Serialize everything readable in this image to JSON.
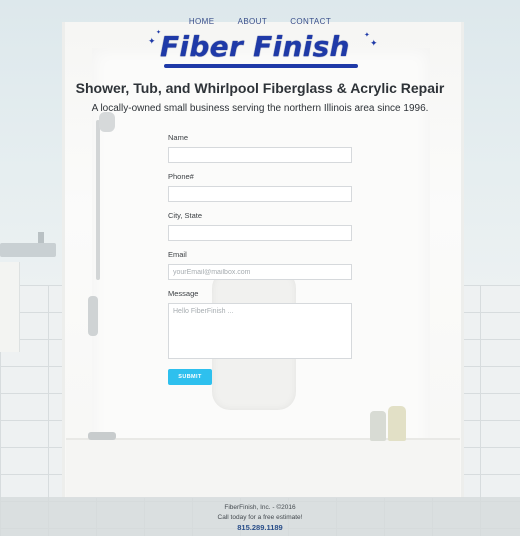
{
  "nav": {
    "items": [
      {
        "label": "HOME"
      },
      {
        "label": "ABOUT"
      },
      {
        "label": "CONTACT"
      }
    ]
  },
  "brand": {
    "logo_text": "Fiber Finish",
    "tagline": "Shower, Tub, and Whirlpool Fiberglass & Acrylic Repair",
    "subline": "A locally-owned small business serving the northern Illinois area since 1996.",
    "logo_color": "#1f3aa8"
  },
  "form": {
    "fields": [
      {
        "label": "Name",
        "placeholder": "",
        "value": ""
      },
      {
        "label": "Phone#",
        "placeholder": "",
        "value": ""
      },
      {
        "label": "City, State",
        "placeholder": "",
        "value": ""
      },
      {
        "label": "Email",
        "placeholder": "yourEmail@mailbox.com",
        "value": ""
      }
    ],
    "message": {
      "label": "Message",
      "placeholder": "Hello FiberFinish ..."
    },
    "submit_label": "SUBMIT",
    "accent_color": "#2ec0ee"
  },
  "footer": {
    "copyright": "FiberFinish, Inc. - ©2016",
    "cta": "Call today for a free estimate!",
    "phone": "815.289.1189"
  }
}
